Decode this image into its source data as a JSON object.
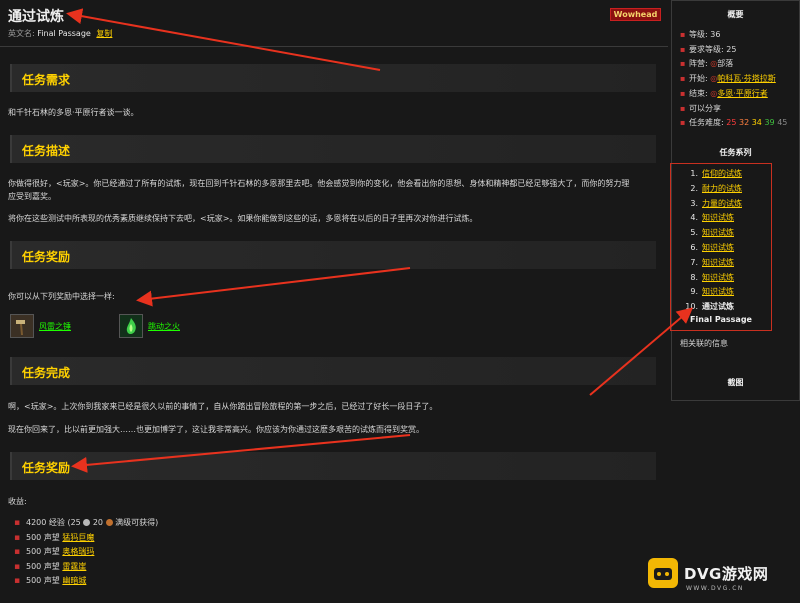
{
  "header": {
    "title": "通过试炼",
    "english_label": "英文名:",
    "english_name": "Final Passage",
    "copy_label": "复制",
    "wowhead_label": "Wowhead"
  },
  "sections": {
    "requirements": {
      "heading": "任务需求",
      "text": "和千针石林的多恩·平原行者谈一谈。"
    },
    "description": {
      "heading": "任务描述",
      "paragraph1_line1": "你做得很好，<玩家>。你已经通过了所有的试炼，现在回到千针石林的多恩那里去吧。他会感觉到你的变化，他会看出你的思想、身体和精神都已经足够强大了，而你的努力理",
      "paragraph1_line2": "应受到嘉奖。",
      "paragraph2": "将你在这些测试中所表现的优秀素质继续保持下去吧，<玩家>。如果你能做到这些的话，多恩将在以后的日子里再次对你进行试炼。"
    },
    "rewards": {
      "heading": "任务奖励",
      "choose_text": "你可以从下列奖励中选择一样:",
      "items": [
        {
          "name": "风雷之锤",
          "icon": "hammer-icon"
        },
        {
          "name": "跳动之火",
          "icon": "flame-icon"
        }
      ]
    },
    "completion": {
      "heading": "任务完成",
      "paragraph1": "啊，<玩家>。上次你到我家来已经是很久以前的事情了，自从你踏出冒险旅程的第一步之后，已经过了好长一段日子了。",
      "paragraph2": "现在你回来了，比以前更加强大……也更加博学了，这让我非常高兴。你应该为你通过这麽多艰苦的试炼而得到奖赏。"
    },
    "gains": {
      "heading": "任务奖励",
      "label": "收益:",
      "xp_text": "4200 经验 (25",
      "xp_tail": "满级可获得)",
      "xp_coin_mid": "20",
      "reputation": [
        {
          "amount": "500 声望",
          "faction": "猛犸巨魔"
        },
        {
          "amount": "500 声望",
          "faction": "奥格瑞玛"
        },
        {
          "amount": "500 声望",
          "faction": "雷霆崖"
        },
        {
          "amount": "500 声望",
          "faction": "幽暗城"
        }
      ]
    }
  },
  "sidebar": {
    "overview_title": "概要",
    "level": "等级: 36",
    "req_level": "要求等级: 25",
    "side_label": "阵营:",
    "side_value": "部落",
    "start_label": "开始:",
    "start_value": "帕科瓦·芬塔拉斯",
    "end_label": "结束:",
    "end_value": "多恩·平原行者",
    "shareable": "可以分享",
    "difficulty_label": "任务难度:",
    "difficulty": [
      "25",
      "32",
      "34",
      "39",
      "45"
    ],
    "chain_title": "任务系列",
    "chain": [
      {
        "n": "1.",
        "name": "信仰的试炼"
      },
      {
        "n": "2.",
        "name": "耐力的试炼"
      },
      {
        "n": "3.",
        "name": "力量的试炼"
      },
      {
        "n": "4.",
        "name": "知识试炼"
      },
      {
        "n": "5.",
        "name": "知识试炼"
      },
      {
        "n": "6.",
        "name": "知识试炼"
      },
      {
        "n": "7.",
        "name": "知识试炼"
      },
      {
        "n": "8.",
        "name": "知识试炼"
      },
      {
        "n": "9.",
        "name": "知识试炼"
      }
    ],
    "chain_current_n": "10.",
    "chain_current": "通过试炼",
    "chain_current_en": "Final Passage",
    "related": "相关联的信息",
    "screenshots": "截图"
  },
  "watermark": {
    "brand": "DVG游戏网",
    "url": "WWW.DVG.CN"
  },
  "colors": {
    "accent": "#ffd100",
    "arrow": "#e8321e",
    "background": "#181818"
  }
}
